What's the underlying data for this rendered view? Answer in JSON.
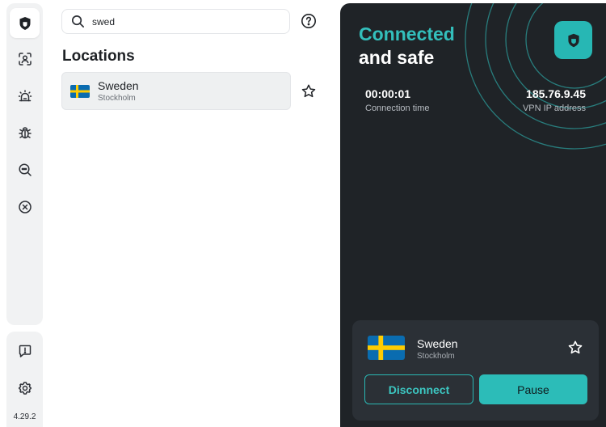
{
  "sidebar": {
    "items": [
      {
        "icon": "shield-icon",
        "active": true
      },
      {
        "icon": "face-scan-icon",
        "active": false
      },
      {
        "icon": "alarm-icon",
        "active": false
      },
      {
        "icon": "bug-icon",
        "active": false
      },
      {
        "icon": "magnify-chat-icon",
        "active": false
      },
      {
        "icon": "block-icon",
        "active": false
      }
    ],
    "bottom_items": [
      {
        "icon": "feedback-icon"
      },
      {
        "icon": "gear-icon"
      }
    ],
    "version": "4.29.2"
  },
  "search": {
    "value": "swed",
    "placeholder": ""
  },
  "locations": {
    "title": "Locations",
    "items": [
      {
        "country": "Sweden",
        "city": "Stockholm",
        "flag": "sweden-flag"
      }
    ]
  },
  "status": {
    "line1": "Connected",
    "line2": "and safe",
    "connection_time": "00:00:01",
    "connection_time_label": "Connection time",
    "ip": "185.76.9.45",
    "ip_label": "VPN IP address"
  },
  "current_location": {
    "country": "Sweden",
    "city": "Stockholm"
  },
  "actions": {
    "disconnect": "Disconnect",
    "pause": "Pause"
  },
  "colors": {
    "accent": "#2cbcb8",
    "panel_bg": "#1f2327",
    "card_bg": "#2b3036",
    "sweden_blue": "#0a6cb0",
    "sweden_yellow": "#fecc02"
  }
}
